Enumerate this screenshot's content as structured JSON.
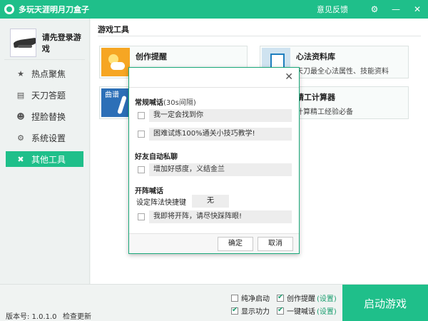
{
  "titlebar": {
    "title": "多玩天涯明月刀盒子",
    "feedback": "意见反馈",
    "icons": [
      "settings-icon",
      "minimize-icon",
      "close-icon"
    ]
  },
  "sidebar": {
    "login_text": "请先登录游戏",
    "items": [
      {
        "label": "热点聚焦",
        "icon": "star-icon"
      },
      {
        "label": "天刀答题",
        "icon": "document-icon"
      },
      {
        "label": "捏脸替换",
        "icon": "face-icon"
      },
      {
        "label": "系统设置",
        "icon": "gear-icon"
      },
      {
        "label": "其他工具",
        "icon": "tools-icon",
        "active": true
      }
    ]
  },
  "main": {
    "section_title": "游戏工具",
    "tools": [
      {
        "name": "创作提醒",
        "desc": ""
      },
      {
        "name": "心法资料库",
        "desc": "天刀最全心法属性、技能资料"
      },
      {
        "name": "",
        "desc": "",
        "icon_text": "曲谱"
      },
      {
        "name": "精工计算器",
        "desc": "计算精工经验必备"
      }
    ]
  },
  "dialog": {
    "group1": {
      "title": "常规喊话",
      "hint": "(30s间隔)",
      "lines": [
        "我一定会找到你",
        "困难试炼100%通关小技巧教学!"
      ]
    },
    "group2": {
      "title": "好友自动私聊",
      "lines": [
        "增加好感度，义结金兰"
      ]
    },
    "group3": {
      "title": "开阵喊话",
      "shortcut_label": "设定阵法快捷键",
      "shortcut_value": "无",
      "lines": [
        "我即将开阵，请尽快踩阵眼!"
      ]
    },
    "ok": "确定",
    "cancel": "取消"
  },
  "bottombar": {
    "version": "版本号: 1.0.1.0",
    "check_update": "检查更新",
    "options": [
      {
        "label": "纯净启动",
        "checked": false
      },
      {
        "label": "创作提醒",
        "checked": true,
        "setting": "(设置)"
      },
      {
        "label": "显示功力",
        "checked": true
      },
      {
        "label": "一键喊话",
        "checked": true,
        "setting": "(设置)"
      }
    ],
    "start": "启动游戏"
  },
  "colors": {
    "accent": "#1fbf8a"
  }
}
